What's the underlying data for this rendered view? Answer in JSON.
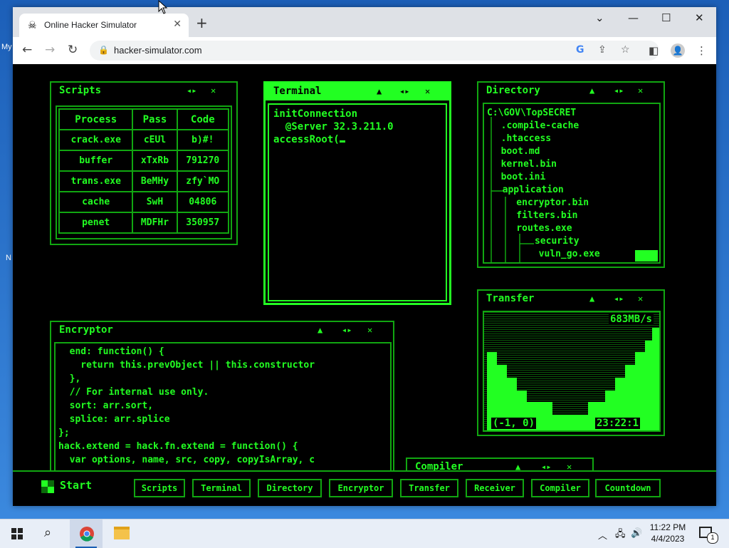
{
  "browser": {
    "tab_title": "Online Hacker Simulator",
    "tab_icon": "pirate-skull-icon",
    "url": "hacker-simulator.com"
  },
  "desktop": {
    "labels": [
      "My",
      "N"
    ]
  },
  "scripts": {
    "title": "Scripts",
    "columns": [
      "Process",
      "Pass",
      "Code"
    ],
    "rows": [
      [
        "crack.exe",
        "cEUl",
        "b)#!"
      ],
      [
        "buffer",
        "xTxRb",
        "791270"
      ],
      [
        "trans.exe",
        "BeMHy",
        "zfy`MO"
      ],
      [
        "cache",
        "SwH",
        "04806"
      ],
      [
        "penet",
        "MDFHr",
        "350957"
      ]
    ]
  },
  "terminal": {
    "title": "Terminal",
    "lines": [
      "initConnection",
      "  @Server 32.3.211.0",
      "accessRoot("
    ]
  },
  "directory": {
    "title": "Directory",
    "tree": [
      "C:\\GOV\\TopSECRET",
      "  .compile-cache",
      "  .htaccess",
      "  boot.md",
      "  kernel.bin",
      "  boot.ini",
      "  application",
      "    encryptor.bin",
      "    filters.bin",
      "    routes.exe",
      "      security",
      "        vuln_go.exe"
    ]
  },
  "transfer": {
    "title": "Transfer",
    "rate": "683MB/s",
    "coords": "(-1, 0)",
    "time": "23:22:1"
  },
  "encryptor": {
    "title": "Encryptor",
    "lines": [
      "  end: function() {",
      "    return this.prevObject || this.constructor",
      "  },",
      "  // For internal use only.",
      "  sort: arr.sort,",
      "  splice: arr.splice",
      "};",
      "hack.extend = hack.fn.extend = function() {",
      "  var options, name, src, copy, copyIsArray, c"
    ]
  },
  "compiler": {
    "title": "Compiler"
  },
  "app_taskbar": {
    "start_label": "Start",
    "buttons": [
      "Scripts",
      "Terminal",
      "Directory",
      "Encryptor",
      "Transfer",
      "Receiver",
      "Compiler",
      "Countdown"
    ]
  },
  "windows_taskbar": {
    "time": "11:22 PM",
    "date": "4/4/2023",
    "notification_count": "1"
  },
  "colors": {
    "accent": "#22ff22",
    "border": "#11a611",
    "bg": "#000000"
  }
}
